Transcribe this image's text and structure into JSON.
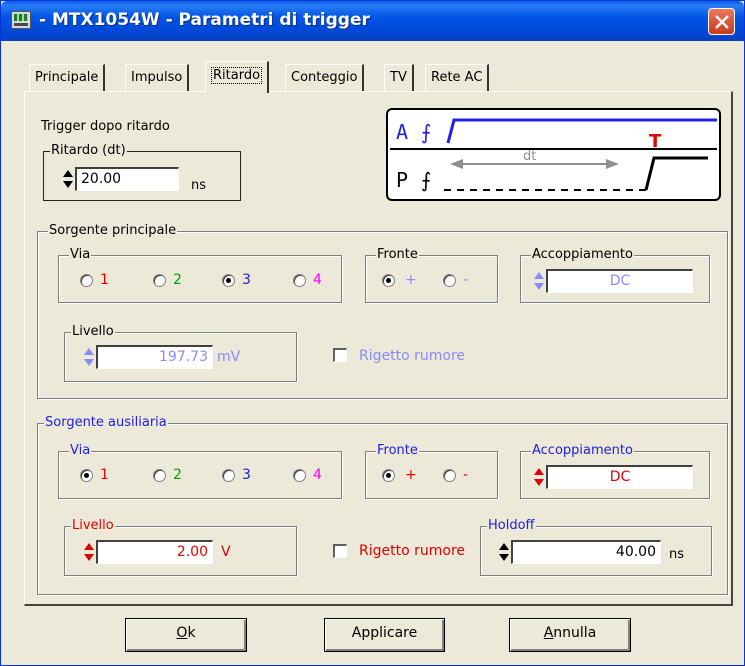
{
  "window": {
    "title": "- MTX1054W - Parametri di trigger",
    "icon": "oscilloscope-app-icon",
    "close_icon": "close-icon"
  },
  "tabs": [
    {
      "label": "Principale",
      "active": false
    },
    {
      "label": "Impulso",
      "active": false
    },
    {
      "label": "Ritardo",
      "active": true
    },
    {
      "label": "Conteggio",
      "active": false
    },
    {
      "label": "TV",
      "active": false
    },
    {
      "label": "Rete AC",
      "active": false
    }
  ],
  "delay": {
    "heading": "Trigger dopo ritardo",
    "group_label": "Ritardo (dt)",
    "value": "20.00",
    "unit": "ns"
  },
  "diagram": {
    "channel_a": "A",
    "channel_p": "P",
    "dt_label": "dt",
    "trigger_mark": "T"
  },
  "main_source": {
    "label": "Sorgente principale",
    "via": {
      "label": "Via",
      "options": [
        "1",
        "2",
        "3",
        "4"
      ],
      "selected": "3"
    },
    "edge": {
      "label": "Fronte",
      "options": [
        "+",
        "-"
      ],
      "selected": "+"
    },
    "coupling": {
      "label": "Accoppiamento",
      "value": "DC"
    },
    "level": {
      "label": "Livello",
      "value": "197.73",
      "unit": "mV"
    },
    "noise_reject": {
      "label": "Rigetto rumore",
      "checked": false
    }
  },
  "aux_source": {
    "label": "Sorgente ausiliaria",
    "via": {
      "label": "Via",
      "options": [
        "1",
        "2",
        "3",
        "4"
      ],
      "selected": "1"
    },
    "edge": {
      "label": "Fronte",
      "options": [
        "+",
        "-"
      ],
      "selected": "+"
    },
    "coupling": {
      "label": "Accoppiamento",
      "value": "DC"
    },
    "level": {
      "label": "Livello",
      "value": "2.00",
      "unit": "V"
    },
    "noise_reject": {
      "label": "Rigetto rumore",
      "checked": false
    },
    "holdoff": {
      "label": "Holdoff",
      "value": "40.00",
      "unit": "ns"
    }
  },
  "buttons": {
    "ok": {
      "label": "Ok",
      "underline_char": "O",
      "rest": "k"
    },
    "apply": {
      "label": "Applicare"
    },
    "cancel": {
      "label": "Annulla",
      "underline_char": "A",
      "rest": "nnulla"
    }
  },
  "colors": {
    "ch1": "#e00000",
    "ch2": "#00a000",
    "ch3": "#2020e0",
    "ch4": "#ff00ff",
    "titlebar": "#0055e5",
    "dialog_bg": "#ece9d8"
  }
}
